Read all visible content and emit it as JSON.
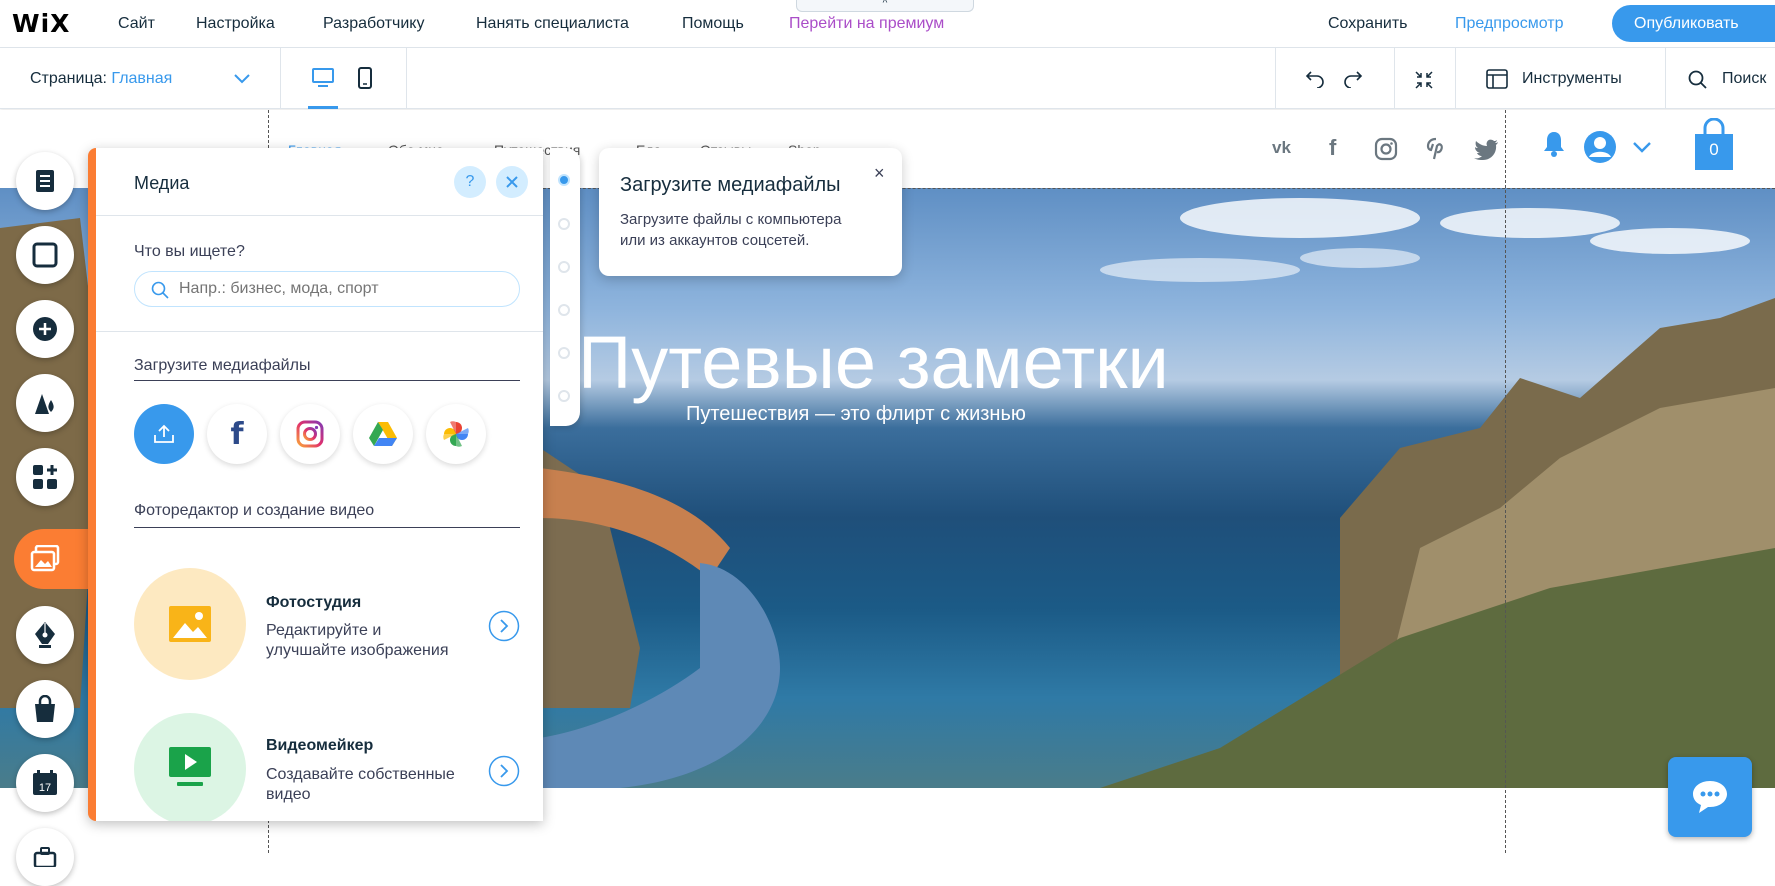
{
  "topbar": {
    "logo": "WiX",
    "menu": [
      "Сайт",
      "Настройка",
      "Разработчику",
      "Нанять специалиста",
      "Помощь",
      "Перейти на премиум"
    ],
    "save": "Сохранить",
    "preview": "Предпросмотр",
    "publish": "Опубликовать",
    "pull_tab": "^"
  },
  "secbar": {
    "page_label": "Страница:",
    "page_value": "Главная",
    "tools": "Инструменты",
    "search": "Поиск"
  },
  "site": {
    "nav": [
      "Главная",
      "Обо мне",
      "Путешествия",
      "Еда",
      "Отзывы",
      "Shop"
    ],
    "hero_title": "Путевые заметки",
    "hero_subtitle": "Путешествия — это флирт с жизнью",
    "cart_count": "0"
  },
  "panel": {
    "title": "Медиа",
    "help": "?",
    "search_label": "Что вы ищете?",
    "search_placeholder": "Напр.: бизнес, мода, спорт",
    "upload_heading": "Загрузите медиафайлы",
    "editor_heading": "Фоторедактор и создание видео",
    "tools": [
      {
        "title": "Фотостудия",
        "desc1": "Редактируйте и",
        "desc2": "улучшайте изображения"
      },
      {
        "title": "Видеомейкер",
        "desc1": "Создавайте собственные",
        "desc2": "видео"
      }
    ]
  },
  "tooltip": {
    "title": "Загрузите медиафайлы",
    "text1": "Загрузите файлы с компьютера",
    "text2": "или из аккаунтов соцсетей.",
    "close": "×"
  },
  "colors": {
    "accent": "#3899ec",
    "premium": "#aa4dc8",
    "orange": "#fb7d33",
    "text": "#162d3d"
  },
  "icons": {
    "rail": [
      "pages-icon",
      "background-icon",
      "add-icon",
      "theme-icon",
      "apps-icon",
      "media-icon",
      "blog-icon",
      "store-icon",
      "bookings-icon"
    ],
    "social": [
      "vk-icon",
      "facebook-icon",
      "instagram-icon",
      "pinterest-icon",
      "twitter-icon"
    ]
  }
}
